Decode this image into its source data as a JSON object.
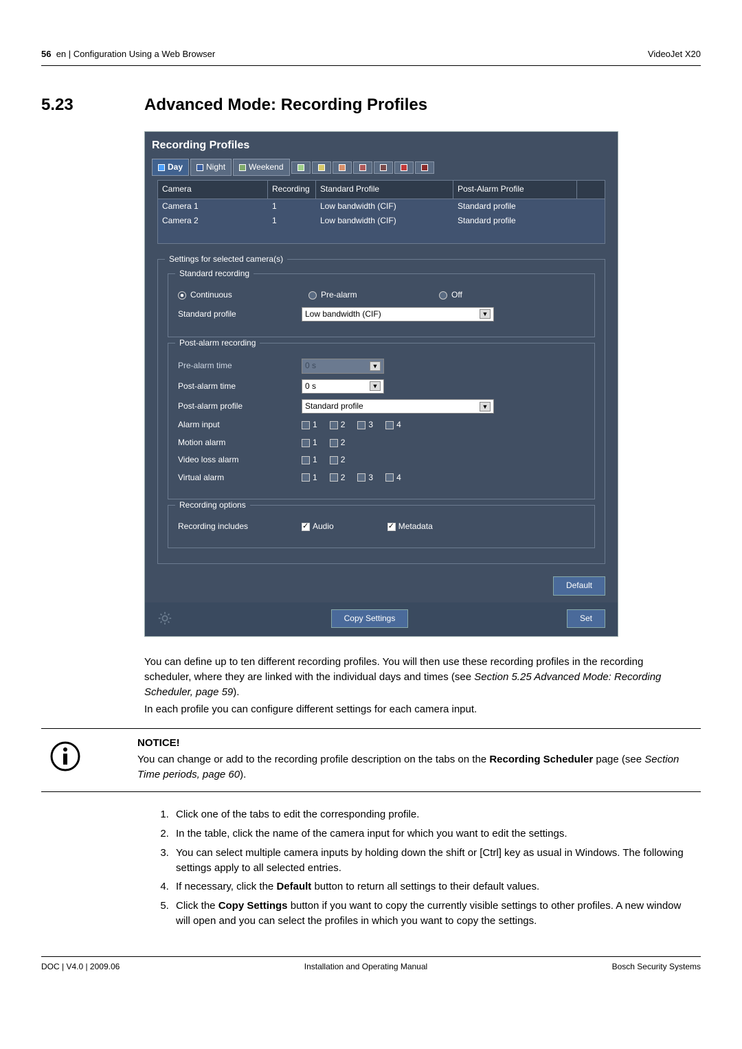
{
  "header": {
    "page": "56",
    "crumb": "en | Configuration Using a Web Browser",
    "product": "VideoJet X20"
  },
  "section": {
    "num": "5.23",
    "title": "Advanced Mode: Recording Profiles"
  },
  "panel": {
    "title": "Recording Profiles",
    "tabs": [
      "Day",
      "Night",
      "Weekend"
    ],
    "thead": {
      "c1": "Camera",
      "c2": "Recording",
      "c3": "Standard Profile",
      "c4": "Post-Alarm Profile"
    },
    "rows": [
      {
        "c1": "Camera 1",
        "c2": "1",
        "c3": "Low bandwidth (CIF)",
        "c4": "Standard profile"
      },
      {
        "c1": "Camera 2",
        "c2": "1",
        "c3": "Low bandwidth (CIF)",
        "c4": "Standard profile"
      }
    ],
    "fs_selected": "Settings for selected camera(s)",
    "fs_std": "Standard recording",
    "r_continuous": "Continuous",
    "r_prealarm": "Pre-alarm",
    "r_off": "Off",
    "std_profile_label": "Standard profile",
    "std_profile_value": "Low bandwidth (CIF)",
    "fs_post": "Post-alarm recording",
    "prealarm_time_label": "Pre-alarm time",
    "prealarm_time_value": "0 s",
    "postalarm_time_label": "Post-alarm time",
    "postalarm_time_value": "0 s",
    "postalarm_profile_label": "Post-alarm profile",
    "postalarm_profile_value": "Standard profile",
    "alarm_input_label": "Alarm input",
    "motion_alarm_label": "Motion alarm",
    "videoloss_alarm_label": "Video loss alarm",
    "virtual_alarm_label": "Virtual alarm",
    "cb_labels": {
      "n1": "1",
      "n2": "2",
      "n3": "3",
      "n4": "4"
    },
    "fs_opts": "Recording options",
    "includes_label": "Recording includes",
    "audio": "Audio",
    "metadata": "Metadata",
    "btn_default": "Default",
    "btn_copy": "Copy Settings",
    "btn_set": "Set"
  },
  "para": {
    "p1": "You can define up to ten different recording profiles. You will then use these recording profiles in the recording scheduler, where they are linked with the individual days and times (see ",
    "p1_em": "Section 5.25 Advanced Mode: Recording Scheduler, page 59",
    "p1_end": ").",
    "p2": "In each profile you can configure different settings for each camera input."
  },
  "notice": {
    "title": "NOTICE!",
    "t1": "You can change or add to the recording profile description on the tabs on the ",
    "b1": "Recording Scheduler",
    "t2": " page (see ",
    "em": "Section   Time periods, page 60",
    "t3": ")."
  },
  "steps": {
    "s1": "Click one of the tabs to edit the corresponding profile.",
    "s2": "In the table, click the name of the camera input for which you want to edit the settings.",
    "s3": "You can select multiple camera inputs by holding down the shift or [Ctrl] key as usual in Windows. The following settings apply to all selected entries.",
    "s4a": "If necessary, click the ",
    "s4b": "Default",
    "s4c": " button to return all settings to their default values.",
    "s5a": "Click the ",
    "s5b": "Copy Settings",
    "s5c": " button if you want to copy the currently visible settings to other profiles. A new window will open and you can select the profiles in which you want to copy the settings."
  },
  "footer": {
    "left": "DOC | V4.0 | 2009.06",
    "center": "Installation and Operating Manual",
    "right": "Bosch Security Systems"
  }
}
